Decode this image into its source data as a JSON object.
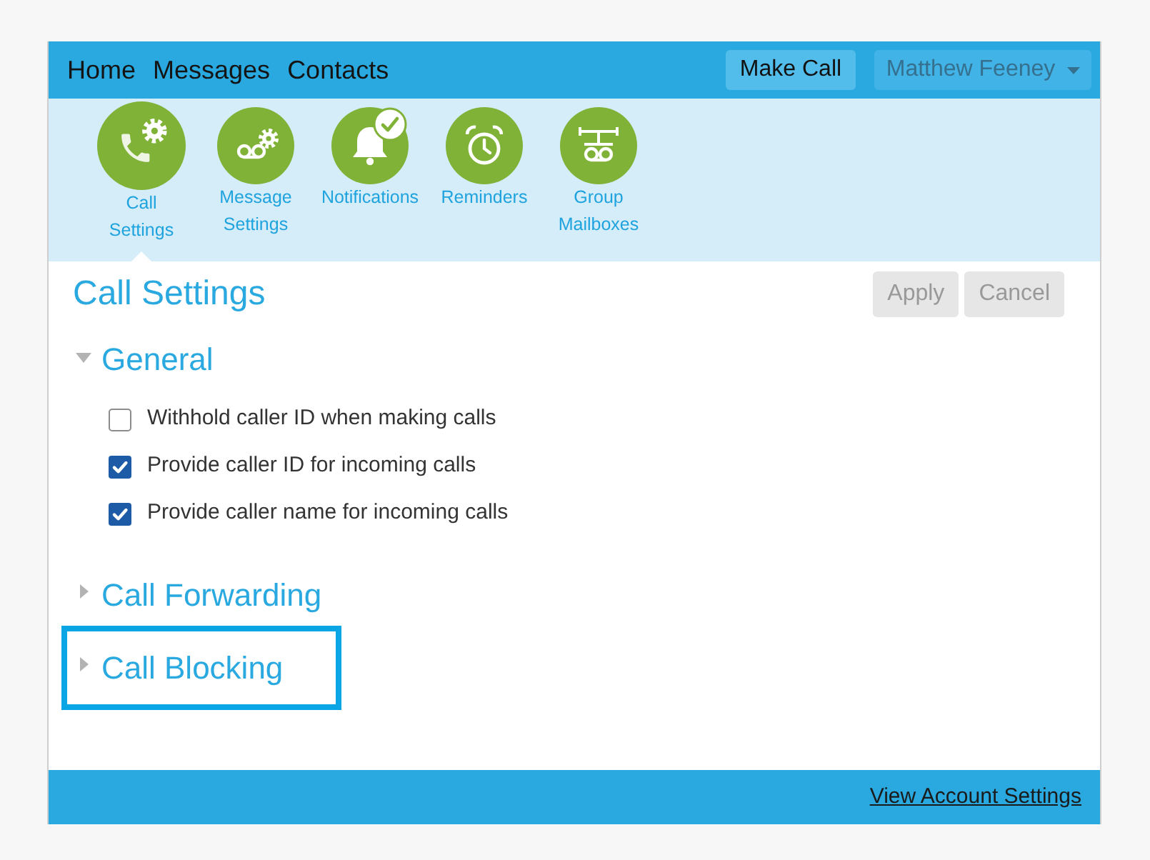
{
  "top_bar": {
    "links": [
      {
        "label": "Home"
      },
      {
        "label": "Messages"
      },
      {
        "label": "Contacts"
      }
    ],
    "make_call_button": "Make Call",
    "user_menu": {
      "label": "Matthew Feeney"
    }
  },
  "settings_tabs": [
    {
      "kind": "call_settings",
      "label_lines": [
        "Call",
        "Settings"
      ],
      "selected": true,
      "check_badge": false
    },
    {
      "kind": "message_settings",
      "label_lines": [
        "Message",
        "Settings"
      ],
      "selected": false,
      "check_badge": false
    },
    {
      "kind": "notifications",
      "label_lines": [
        "Notifications"
      ],
      "selected": false,
      "check_badge": true
    },
    {
      "kind": "reminders",
      "label_lines": [
        "Reminders"
      ],
      "selected": false,
      "check_badge": false
    },
    {
      "kind": "group_mailboxes",
      "label_lines": [
        "Group",
        "Mailboxes"
      ],
      "selected": false,
      "check_badge": false
    }
  ],
  "page": {
    "title": "Call Settings",
    "actions": [
      {
        "label": "Apply",
        "disabled": true
      },
      {
        "label": "Cancel",
        "disabled": true
      }
    ]
  },
  "sections": [
    {
      "title": "General",
      "expanded": true,
      "highlighted": false,
      "options": [
        {
          "label": "Withhold caller ID when making calls",
          "checked": false
        },
        {
          "label": "Provide caller ID for incoming calls",
          "checked": true
        },
        {
          "label": "Provide caller name for incoming calls",
          "checked": true
        }
      ]
    },
    {
      "title": "Call Forwarding",
      "expanded": false,
      "highlighted": false
    },
    {
      "title": "Call Blocking",
      "expanded": false,
      "highlighted": true
    }
  ],
  "footer": {
    "link": "View Account Settings"
  }
}
